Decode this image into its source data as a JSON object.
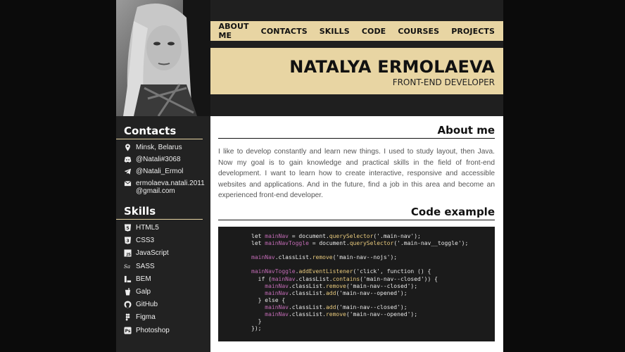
{
  "nav": {
    "items": [
      "ABOUT ME",
      "CONTACTS",
      "SKILLS",
      "CODE",
      "COURSES",
      "PROJECTS"
    ]
  },
  "header": {
    "name": "NATALYA ERMOLAEVA",
    "role": "FRONT-END DEVELOPER"
  },
  "contacts": {
    "title": "Contacts",
    "items": [
      {
        "icon": "location-icon",
        "text": "Minsk, Belarus"
      },
      {
        "icon": "discord-icon",
        "text": "@Natali#3068"
      },
      {
        "icon": "telegram-icon",
        "text": "@Natali_Ermol"
      },
      {
        "icon": "mail-icon",
        "text": "ermolaeva.natali.2011 @gmail.com"
      }
    ]
  },
  "skills": {
    "title": "Skills",
    "items": [
      {
        "icon": "html5-icon",
        "text": "HTML5"
      },
      {
        "icon": "css3-icon",
        "text": "CSS3"
      },
      {
        "icon": "javascript-icon",
        "text": "JavaScript"
      },
      {
        "icon": "sass-icon",
        "text": "SASS"
      },
      {
        "icon": "bem-icon",
        "text": "BEM"
      },
      {
        "icon": "gulp-icon",
        "text": "Galp"
      },
      {
        "icon": "github-icon",
        "text": "GitHub"
      },
      {
        "icon": "figma-icon",
        "text": "Figma"
      },
      {
        "icon": "photoshop-icon",
        "text": "Photoshop"
      }
    ]
  },
  "about": {
    "title": "About me",
    "text": "I like to develop constantly and learn new things. I used to study layout, then Java. Now my goal is to gain knowledge and practical skills in the field of front-end development. I want to learn how to create interactive, responsive and accessible websites and applications. And in the future, find a job in this area and become an experienced front-end developer."
  },
  "code": {
    "title": "Code example",
    "lines": [
      "let mainNav = document.querySelector('.main-nav');",
      "let mainNavToggle = document.querySelector('.main-nav__toggle');",
      "",
      "mainNav.classList.remove('main-nav--nojs');",
      "",
      "mainNavToggle.addEventListener('click', function () {",
      "  if (mainNav.classList.contains('main-nav--closed')) {",
      "    mainNav.classList.remove('main-nav--closed');",
      "    mainNav.classList.add('main-nav--opened');",
      "  } else {",
      "    mainNav.classList.add('main-nav--closed');",
      "    mainNav.classList.remove('main-nav--opened');",
      "  }",
      "});"
    ]
  },
  "colors": {
    "accent": "#e8d5a3",
    "dark": "#222222",
    "code_var": "#c26bb5",
    "code_fn": "#e8c97c"
  }
}
